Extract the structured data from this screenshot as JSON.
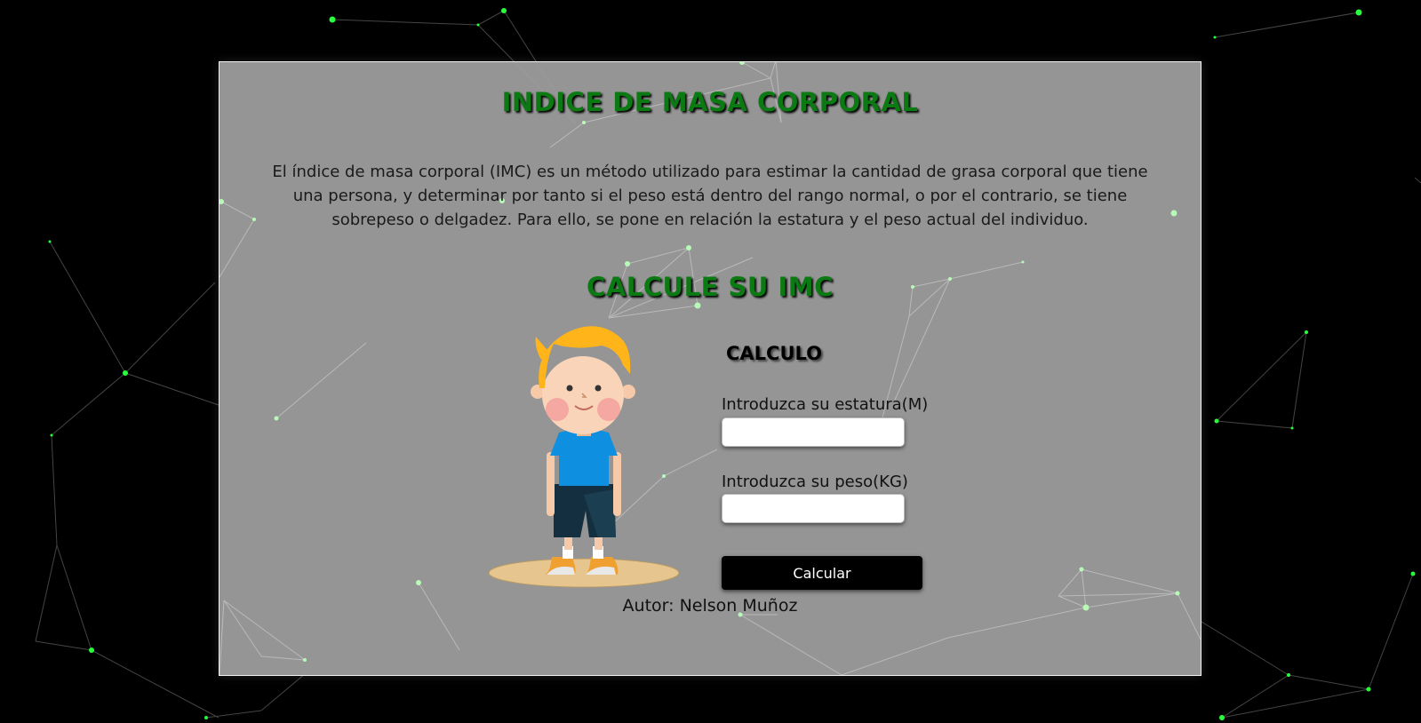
{
  "header": {
    "title": "INDICE DE MASA CORPORAL",
    "description": "El índice de masa corporal (IMC) es un método utilizado para estimar la cantidad de grasa corporal que tiene una persona, y determinar por tanto si el peso está dentro del rango normal, o por el contrario, se tiene sobrepeso o delgadez. Para ello, se pone en relación la estatura y el peso actual del individuo."
  },
  "calculator": {
    "section_title": "CALCULE SU IMC",
    "illustration": "boy-illustration",
    "form_title": "CALCULO",
    "height_label": "Introduzca su estatura(M)",
    "height_value": "",
    "weight_label": "Introduzca su peso(KG)",
    "weight_value": "",
    "submit_label": "Calcular"
  },
  "footer": {
    "author": "Autor: Nelson Muñoz"
  },
  "colors": {
    "background": "#000000",
    "panel": "#a0a0a0",
    "title_green": "#0b7a12",
    "particle_green": "#28ff3c",
    "button": "#000000"
  }
}
